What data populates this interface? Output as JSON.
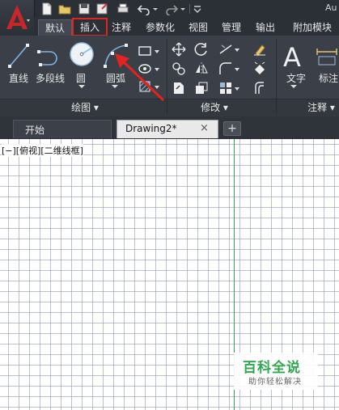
{
  "app": {
    "title": "Au"
  },
  "ribbon_tabs": [
    "默认",
    "插入",
    "注释",
    "参数化",
    "视图",
    "管理",
    "输出",
    "附加模块"
  ],
  "draw_panel": {
    "tools": [
      "直线",
      "多段线",
      "圆",
      "圆弧"
    ],
    "label": "绘图"
  },
  "modify_panel": {
    "label": "修改"
  },
  "annotate_panel": {
    "tools": [
      "文字",
      "标注"
    ],
    "label": "注释"
  },
  "doc_tabs": {
    "start": "开始",
    "drawing": "Drawing2*",
    "close": "×",
    "new": "+"
  },
  "viewport": {
    "label": "[−][俯视][二维线框]"
  },
  "watermark": {
    "title": "百科全说",
    "subtitle": "助你轻松解决"
  },
  "colors": {
    "highlight": "#e0241f",
    "accent_green": "#2fa84f",
    "ribbon_bg": "#3b4048"
  }
}
